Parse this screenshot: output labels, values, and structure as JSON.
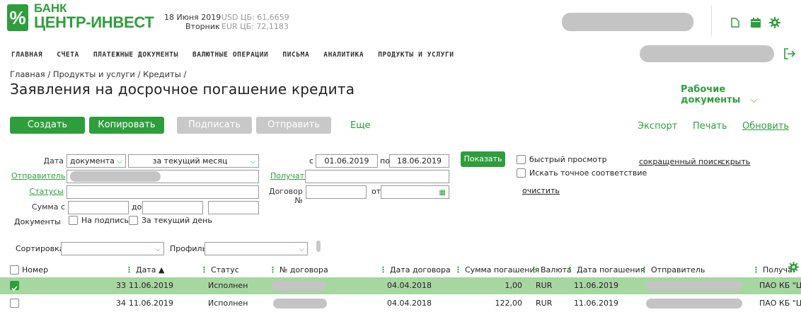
{
  "header": {
    "logo_symbol": "%",
    "logo_line1": "БАНК",
    "logo_line2": "ЦЕНТР-ИНВЕСТ",
    "date": "18 Июня 2019",
    "weekday": "Вторник",
    "usd": "USD ЦБ: 61,6659",
    "eur": "EUR ЦБ: 72,1183"
  },
  "nav": [
    "ГЛАВНАЯ",
    "СЧЕТА",
    "ПЛАТЕЖНЫЕ ДОКУМЕНТЫ",
    "ВАЛЮТНЫЕ ОПЕРАЦИИ",
    "ПИСЬМА",
    "АНАЛИТИКА",
    "ПРОДУКТЫ И УСЛУГИ"
  ],
  "breadcrumb": "Главная / Продукты и услуги / Кредиты /",
  "page_title": "Заявления на досрочное погашение кредита",
  "working_docs": "Рабочие документы",
  "toolbar": {
    "create": "Создать",
    "copy": "Копировать",
    "sign": "Подписать",
    "send": "Отправить",
    "more": "Еще",
    "export": "Экспорт",
    "print": "Печать",
    "refresh": "Обновить"
  },
  "filters": {
    "date_label": "Дата",
    "date_type": "документа",
    "period": "за текущий месяц",
    "from_label": "с",
    "from_value": "01.06.2019",
    "to_label": "по",
    "to_value": "18.06.2019",
    "show": "Показать",
    "quick_view": "быстрый просмотр",
    "exact_match": "Искать точное соответствие",
    "short_search": "сокращенный поиск",
    "hide": "скрыть",
    "sender": "Отправитель",
    "receiver": "Получатель",
    "statuses": "Статусы",
    "contract_no": "Договор №",
    "from2": "от",
    "clear": "очистить",
    "amount_from": "Сумма с",
    "amount_to": "до",
    "documents": "Документы",
    "to_sign": "На подпись",
    "today": "За текущий день"
  },
  "sort": {
    "sort_label": "Сортировка",
    "profile_label": "Профиль"
  },
  "table": {
    "headers": [
      "Номер",
      "Дата ▲",
      "Статус",
      "№ договора",
      "Дата договора",
      "Сумма погашения",
      "Валюта",
      "Дата погашения",
      "Отправитель",
      "Получатель"
    ],
    "rows": [
      {
        "number": "33",
        "date": "11.06.2019",
        "status": "Исполнен",
        "contract_date": "04.04.2018",
        "amount": "1,00",
        "currency": "RUR",
        "repay_date": "11.06.2019",
        "receiver": "ПАО КБ \"ЦЕ",
        "checked": true
      },
      {
        "number": "34",
        "date": "11.06.2019",
        "status": "Исполнен",
        "contract_date": "04.04.2018",
        "amount": "122,00",
        "currency": "RUR",
        "repay_date": "11.06.2019",
        "receiver": "ПАО КБ \"ЦЕ",
        "checked": false
      }
    ]
  },
  "colors": {
    "accent": "#2e9e3c",
    "selected_row": "#a6d7a0",
    "disabled": "#c8c8c8"
  }
}
